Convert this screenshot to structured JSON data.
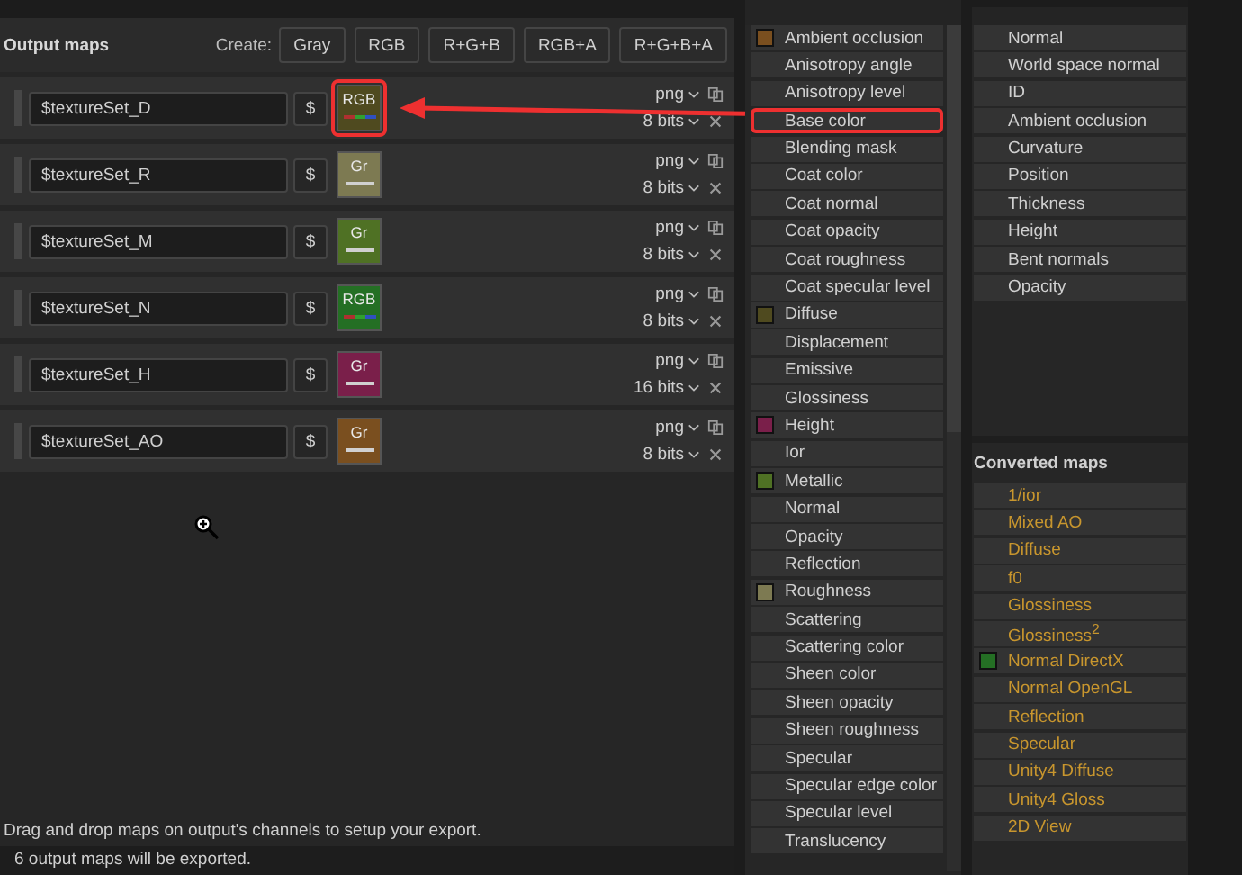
{
  "output_panel": {
    "title": "Output maps",
    "create_label": "Create:",
    "create_buttons": [
      "Gray",
      "RGB",
      "R+G+B",
      "RGB+A",
      "R+G+B+A"
    ],
    "outputs": [
      {
        "name": "$textureSet_D",
        "dollar": "$",
        "kind": "rgb",
        "channel": "RGB",
        "color": "#4f4a1f",
        "format": "png",
        "bits": "8 bits",
        "highlighted": true
      },
      {
        "name": "$textureSet_R",
        "dollar": "$",
        "kind": "gray",
        "channel": "Gr",
        "color": "#7d7a52",
        "format": "png",
        "bits": "8 bits",
        "highlighted": false
      },
      {
        "name": "$textureSet_M",
        "dollar": "$",
        "kind": "gray",
        "channel": "Gr",
        "color": "#4f7124",
        "format": "png",
        "bits": "8 bits",
        "highlighted": false
      },
      {
        "name": "$textureSet_N",
        "dollar": "$",
        "kind": "rgb",
        "channel": "RGB",
        "color": "#246f24",
        "format": "png",
        "bits": "8 bits",
        "highlighted": false
      },
      {
        "name": "$textureSet_H",
        "dollar": "$",
        "kind": "gray",
        "channel": "Gr",
        "color": "#7a1f4a",
        "format": "png",
        "bits": "16 bits",
        "highlighted": false
      },
      {
        "name": "$textureSet_AO",
        "dollar": "$",
        "kind": "gray",
        "channel": "Gr",
        "color": "#7a4f1f",
        "format": "png",
        "bits": "8 bits",
        "highlighted": false
      }
    ],
    "hint": "Drag and drop maps on output's channels to setup your export.",
    "status": "6 output maps will be exported."
  },
  "input_maps": [
    {
      "label": "Ambient occlusion",
      "color": "#7a4f1f",
      "highlighted": false
    },
    {
      "label": "Anisotropy angle",
      "highlighted": false
    },
    {
      "label": "Anisotropy level",
      "highlighted": false
    },
    {
      "label": "Base color",
      "highlighted": true
    },
    {
      "label": "Blending mask",
      "highlighted": false
    },
    {
      "label": "Coat color",
      "highlighted": false
    },
    {
      "label": "Coat normal",
      "highlighted": false
    },
    {
      "label": "Coat opacity",
      "highlighted": false
    },
    {
      "label": "Coat roughness",
      "highlighted": false
    },
    {
      "label": "Coat specular level",
      "highlighted": false
    },
    {
      "label": "Diffuse",
      "color": "#4f4a1f",
      "highlighted": false
    },
    {
      "label": "Displacement",
      "highlighted": false
    },
    {
      "label": "Emissive",
      "highlighted": false
    },
    {
      "label": "Glossiness",
      "highlighted": false
    },
    {
      "label": "Height",
      "color": "#7a1f4a",
      "highlighted": false
    },
    {
      "label": "Ior",
      "highlighted": false
    },
    {
      "label": "Metallic",
      "color": "#4f7124",
      "highlighted": false
    },
    {
      "label": "Normal",
      "highlighted": false
    },
    {
      "label": "Opacity",
      "highlighted": false
    },
    {
      "label": "Reflection",
      "highlighted": false
    },
    {
      "label": "Roughness",
      "color": "#7d7a52",
      "highlighted": false
    },
    {
      "label": "Scattering",
      "highlighted": false
    },
    {
      "label": "Scattering color",
      "highlighted": false
    },
    {
      "label": "Sheen color",
      "highlighted": false
    },
    {
      "label": "Sheen opacity",
      "highlighted": false
    },
    {
      "label": "Sheen roughness",
      "highlighted": false
    },
    {
      "label": "Specular",
      "highlighted": false
    },
    {
      "label": "Specular edge color",
      "highlighted": false
    },
    {
      "label": "Specular level",
      "highlighted": false
    },
    {
      "label": "Translucency",
      "highlighted": false
    }
  ],
  "mesh_maps": [
    {
      "label": "Normal"
    },
    {
      "label": "World space normal"
    },
    {
      "label": "ID"
    },
    {
      "label": "Ambient occlusion"
    },
    {
      "label": "Curvature"
    },
    {
      "label": "Position"
    },
    {
      "label": "Thickness"
    },
    {
      "label": "Height"
    },
    {
      "label": "Bent normals"
    },
    {
      "label": "Opacity"
    }
  ],
  "converted_maps": {
    "title": "Converted maps",
    "items": [
      {
        "label": "1/ior"
      },
      {
        "label": "Mixed AO"
      },
      {
        "label": "Diffuse"
      },
      {
        "label": "f0"
      },
      {
        "label": "Glossiness"
      },
      {
        "label": "Glossiness$^{2}$"
      },
      {
        "label": "Normal DirectX",
        "color": "#246f24"
      },
      {
        "label": "Normal OpenGL"
      },
      {
        "label": "Reflection"
      },
      {
        "label": "Specular"
      },
      {
        "label": "Unity4 Diffuse"
      },
      {
        "label": "Unity4 Gloss"
      },
      {
        "label": "2D View"
      }
    ]
  }
}
